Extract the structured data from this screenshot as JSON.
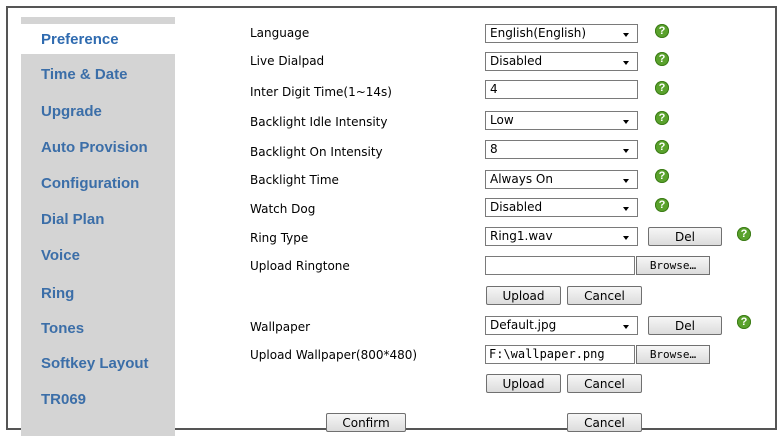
{
  "sidebar": {
    "items": [
      {
        "label": "Preference"
      },
      {
        "label": "Time & Date"
      },
      {
        "label": "Upgrade"
      },
      {
        "label": "Auto Provision"
      },
      {
        "label": "Configuration"
      },
      {
        "label": "Dial Plan"
      },
      {
        "label": "Voice"
      },
      {
        "label": "Ring"
      },
      {
        "label": "Tones"
      },
      {
        "label": "Softkey Layout"
      },
      {
        "label": "TR069"
      }
    ]
  },
  "form": {
    "language": {
      "label": "Language",
      "value": "English(English)"
    },
    "live_dialpad": {
      "label": "Live Dialpad",
      "value": "Disabled"
    },
    "inter_digit_time": {
      "label": "Inter Digit Time(1~14s)",
      "value": "4"
    },
    "backlight_idle": {
      "label": "Backlight Idle Intensity",
      "value": "Low"
    },
    "backlight_on": {
      "label": "Backlight On Intensity",
      "value": "8"
    },
    "backlight_time": {
      "label": "Backlight Time",
      "value": "Always On"
    },
    "watch_dog": {
      "label": "Watch Dog",
      "value": "Disabled"
    },
    "ring_type": {
      "label": "Ring Type",
      "value": "Ring1.wav",
      "del_label": "Del"
    },
    "upload_ringtone": {
      "label": "Upload Ringtone",
      "file_value": "",
      "browse_label": "Browse…",
      "upload_label": "Upload",
      "cancel_label": "Cancel"
    },
    "wallpaper": {
      "label": "Wallpaper",
      "value": "Default.jpg",
      "del_label": "Del"
    },
    "upload_wallpaper": {
      "label": "Upload Wallpaper(800*480)",
      "file_value": "F:\\wallpaper.png",
      "browse_label": "Browse…",
      "upload_label": "Upload",
      "cancel_label": "Cancel"
    }
  },
  "footer": {
    "confirm_label": "Confirm",
    "cancel_label": "Cancel"
  },
  "help_glyph": "?",
  "colors": {
    "sidebar_bg": "#d4d4d4",
    "sidebar_text": "#3b6ea8",
    "help_green": "#5aa22c"
  }
}
